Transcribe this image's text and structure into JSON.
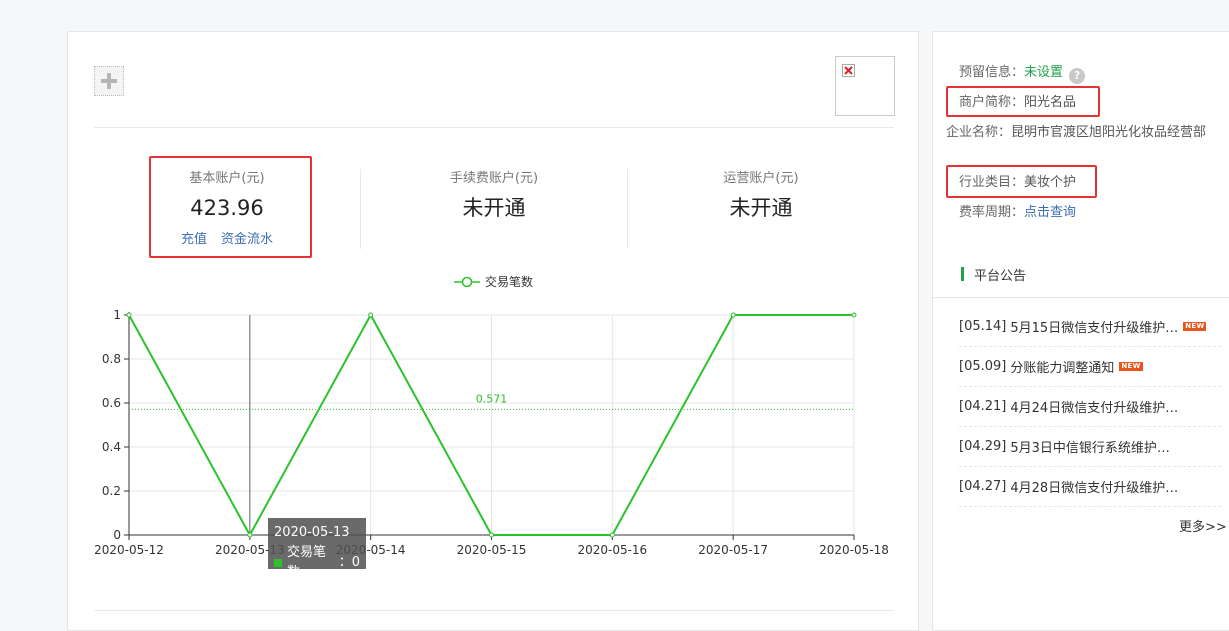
{
  "accounts": [
    {
      "label": "基本账户(元)",
      "value": "423.96",
      "links": [
        "充值",
        "资金流水"
      ]
    },
    {
      "label": "手续费账户(元)",
      "value": "未开通"
    },
    {
      "label": "运营账户(元)",
      "value": "未开通"
    }
  ],
  "chart": {
    "legend_label": "交易笔数",
    "avg_label": "0.571",
    "tooltip": {
      "date": "2020-05-13",
      "series": "交易笔数",
      "value": "0"
    }
  },
  "chart_data": {
    "type": "line",
    "x": [
      "2020-05-12",
      "2020-05-13",
      "2020-05-14",
      "2020-05-15",
      "2020-05-16",
      "2020-05-17",
      "2020-05-18"
    ],
    "series": [
      {
        "name": "交易笔数",
        "values": [
          1,
          0,
          1,
          0,
          0,
          1,
          1
        ]
      }
    ],
    "average": 0.571,
    "ylim": [
      0,
      1
    ],
    "yticks": [
      "0",
      "0.2",
      "0.4",
      "0.6",
      "0.8",
      "1"
    ],
    "grid": true,
    "legend_position": "top",
    "colors": {
      "line": "#2bc22b",
      "avg_line": "#2bc22b",
      "grid": "#e6e6e6",
      "axis": "#333333"
    }
  },
  "merchant": {
    "reserve_key": "预留信息：",
    "reserve_value": "未设置",
    "short_name_key": "商户简称：",
    "short_name_value": "阳光名品",
    "company_key": "企业名称：",
    "company_value": "昆明市官渡区旭阳光化妆品经营部",
    "industry_key": "行业类目：",
    "industry_value": "美妆个护",
    "rate_key": "费率周期：",
    "rate_value": "点击查询"
  },
  "notices": {
    "title": "平台公告",
    "items": [
      {
        "date": "[05.14]",
        "title": "5月15日微信支付升级维护…",
        "new": true
      },
      {
        "date": "[05.09]",
        "title": "分账能力调整通知",
        "new": true
      },
      {
        "date": "[04.21]",
        "title": "4月24日微信支付升级维护…",
        "new": false
      },
      {
        "date": "[04.29]",
        "title": "5月3日中信银行系统维护…",
        "new": false
      },
      {
        "date": "[04.27]",
        "title": "4月28日微信支付升级维护…",
        "new": false
      }
    ],
    "more": "更多>>",
    "new_badge": "NEW"
  },
  "colors": {
    "accent_green": "#22a14b",
    "link_blue": "#3d6fb4",
    "highlight_red": "#e53333"
  }
}
